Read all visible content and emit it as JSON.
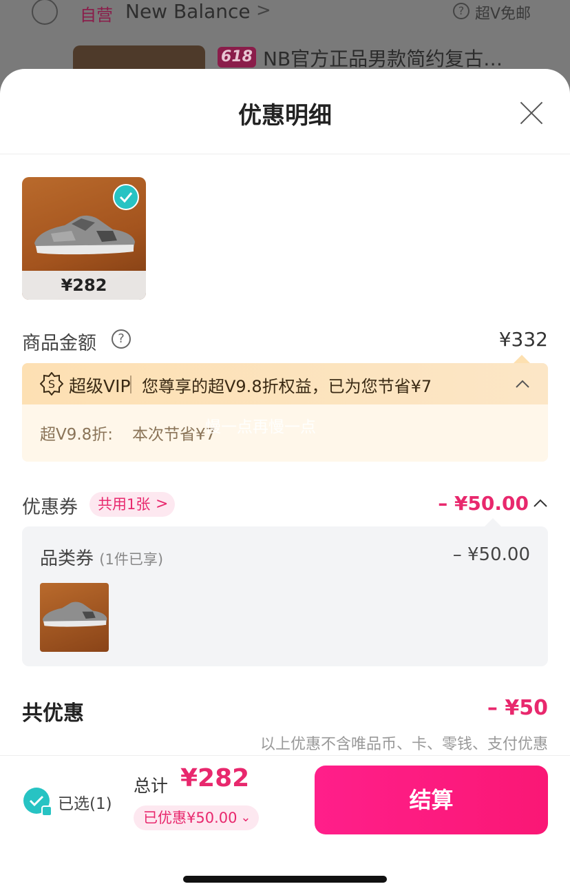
{
  "background": {
    "self_operated_tag": "自营",
    "store_name": "New Balance",
    "store_chevron": ">",
    "help_icon": "?",
    "free_shipping": "超V免邮",
    "promo_tag": "618",
    "product_title": "NB官方正品男款简约复古…"
  },
  "sheet": {
    "title": "优惠明细",
    "close_icon": "close-icon"
  },
  "product": {
    "price": "¥282",
    "selected": true
  },
  "goods_amount": {
    "label": "商品金额",
    "help": "?",
    "value": "¥332"
  },
  "vip": {
    "name": "超级VIP",
    "text": "您尊享的超V9.8折权益，已为您节省¥7",
    "detail_label": "超V9.8折:",
    "detail_value": "本次节省¥7",
    "badge": "S"
  },
  "watermark": "慢一点再慢一点",
  "coupon": {
    "label": "优惠券",
    "shared_pill": "共用1张",
    "pill_chevron": ">",
    "total": "– ¥50.00",
    "item": {
      "name": "品类券",
      "note": "(1件已享)",
      "amount": "– ¥50.00"
    }
  },
  "total_discount": {
    "label": "共优惠",
    "value": "– ¥50",
    "note": "以上优惠不含唯品币、卡、零钱、支付优惠"
  },
  "footer": {
    "selected_label": "已选(1)",
    "total_label": "总计",
    "total_price": "¥282",
    "saved_label": "已优惠¥50.00",
    "saved_chevron": "⌄",
    "checkout_label": "结算"
  },
  "colors": {
    "accent": "#e8286d",
    "checkout": "#ff1f8a",
    "teal_check": "#27c3c3",
    "vip_bg": "#fff7ea"
  }
}
